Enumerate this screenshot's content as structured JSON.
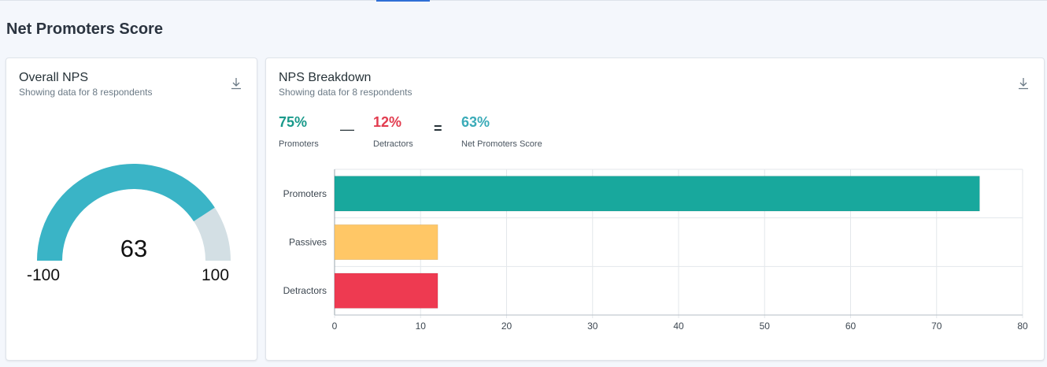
{
  "page": {
    "title": "Net Promoters Score"
  },
  "overall": {
    "title": "Overall NPS",
    "subtitle": "Showing data for 8 respondents",
    "download_icon": "download-icon",
    "gauge": {
      "value": 63,
      "value_text": "63",
      "min": -100,
      "min_text": "-100",
      "max": 100,
      "max_text": "100"
    }
  },
  "breakdown": {
    "title": "NPS Breakdown",
    "subtitle": "Showing data for 8 respondents",
    "download_icon": "download-icon",
    "metrics": {
      "promoters": {
        "value": "75%",
        "label": "Promoters"
      },
      "minus": "—",
      "detractors": {
        "value": "12%",
        "label": "Detractors"
      },
      "equals": "=",
      "nps": {
        "value": "63%",
        "label": "Net Promoters Score"
      }
    }
  },
  "colors": {
    "gauge_fill": "#3ab4c6",
    "gauge_track": "#d3dfe4",
    "promoters": "#18a89d",
    "passives": "#ffc766",
    "detractors": "#ee3a51",
    "promoters_text": "#1a9a8b",
    "detractors_text": "#e23b4e",
    "nps_text": "#3aabb8"
  },
  "chart_data": {
    "type": "bar",
    "orientation": "horizontal",
    "categories": [
      "Promoters",
      "Passives",
      "Detractors"
    ],
    "values": [
      75,
      12,
      12
    ],
    "xlim": [
      0,
      80
    ],
    "xticks": [
      0,
      10,
      20,
      30,
      40,
      50,
      60,
      70,
      80
    ],
    "grid": true
  }
}
